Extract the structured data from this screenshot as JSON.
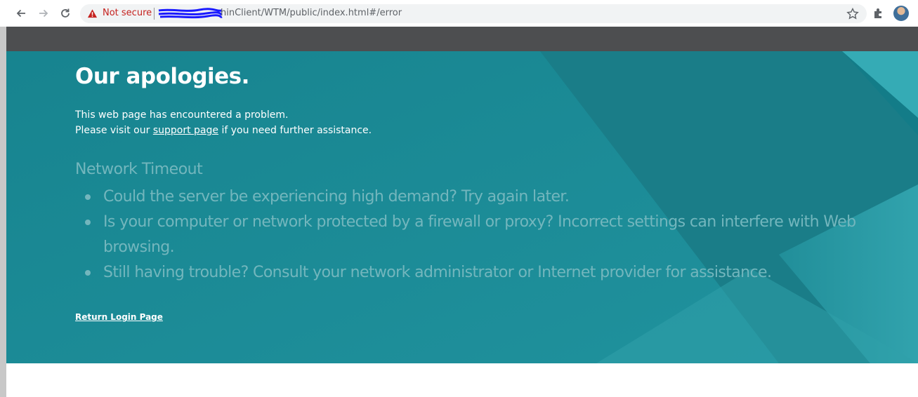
{
  "browser": {
    "security_label": "Not secure",
    "url": "hinClient/WTM/public/index.html#/error"
  },
  "error_page": {
    "title": "Our apologies.",
    "line1": "This web page has encountered a problem.",
    "line2_prefix": "Please visit our ",
    "support_link": "support page",
    "line2_suffix": " if you need further assistance.",
    "subtitle": "Network Timeout",
    "bullets": [
      "Could the server be experiencing high demand? Try again later.",
      "Is your computer or network protected by a firewall or proxy? Incorrect settings can interfere with Web browsing.",
      "Still having trouble? Consult your network administrator or Internet provider for assistance."
    ],
    "return_link": "Return Login Page"
  },
  "colors": {
    "teal": "#157f8b",
    "topbar": "#4d4e50",
    "faded_text": "#73b6bd"
  }
}
